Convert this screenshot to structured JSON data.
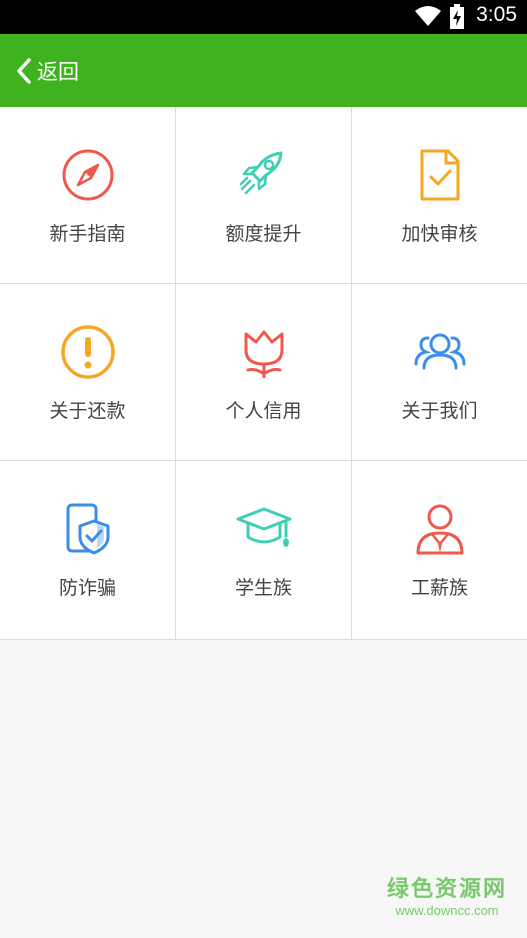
{
  "status_bar": {
    "time": "3:05",
    "wifi_icon": "wifi-icon",
    "battery_icon": "battery-charging-icon"
  },
  "app_bar": {
    "back_label": "返回",
    "color": "#3fb31f"
  },
  "grid": {
    "items": [
      {
        "label": "新手指南",
        "icon": "compass-icon",
        "color": "#f0584e"
      },
      {
        "label": "额度提升",
        "icon": "rocket-icon",
        "color": "#3fcfb4"
      },
      {
        "label": "加快审核",
        "icon": "document-check-icon",
        "color": "#f5a623"
      },
      {
        "label": "关于还款",
        "icon": "exclamation-icon",
        "color": "#f5a623"
      },
      {
        "label": "个人信用",
        "icon": "tulip-icon",
        "color": "#f0584e"
      },
      {
        "label": "关于我们",
        "icon": "people-icon",
        "color": "#3a8ee8"
      },
      {
        "label": "防诈骗",
        "icon": "phone-shield-icon",
        "color": "#3a8ee8"
      },
      {
        "label": "学生族",
        "icon": "graduation-cap-icon",
        "color": "#3fcfb4"
      },
      {
        "label": "工薪族",
        "icon": "worker-icon",
        "color": "#f0584e"
      }
    ]
  },
  "watermark": {
    "line1": "绿色资源网",
    "line2": "www.downcc.com"
  }
}
